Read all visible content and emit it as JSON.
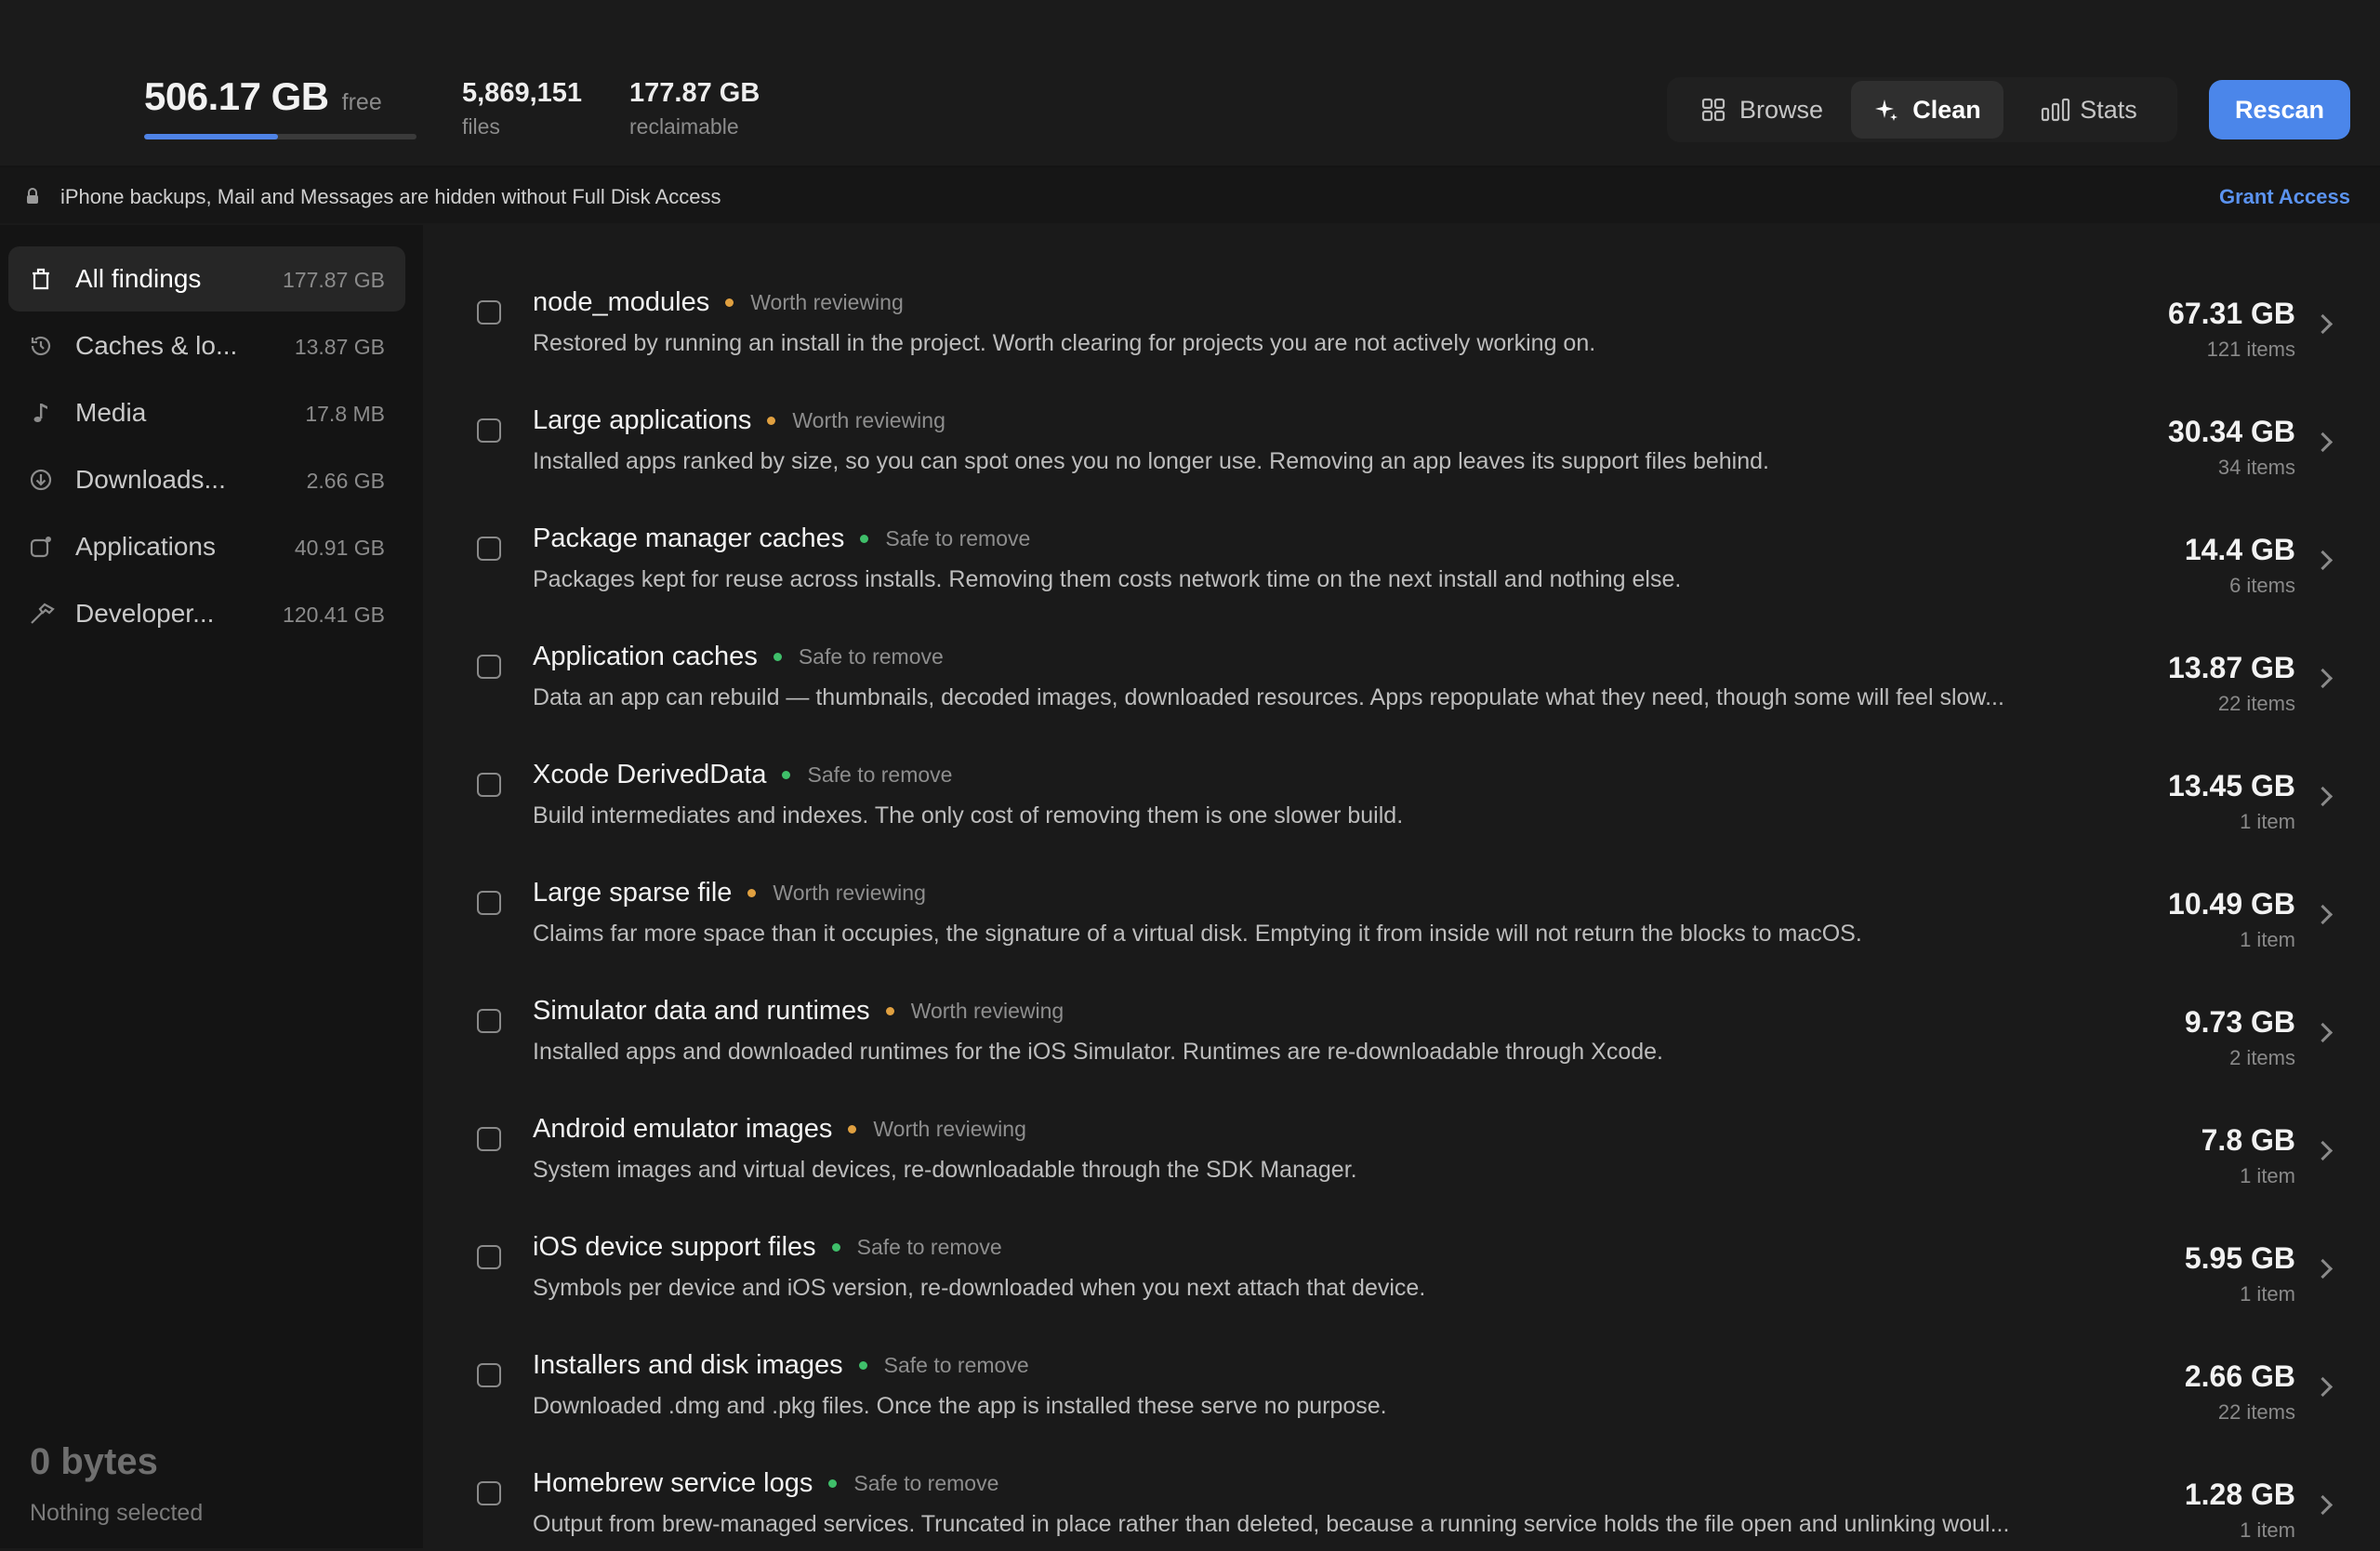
{
  "header": {
    "free_value": "506.17 GB",
    "free_unit": "free",
    "disk_used_fraction": 0.49,
    "files_value": "5,869,151",
    "files_label": "files",
    "reclaimable_value": "177.87 GB",
    "reclaimable_label": "reclaimable",
    "tabs": [
      {
        "label": "Browse",
        "icon": "grid-icon",
        "active": false
      },
      {
        "label": "Clean",
        "icon": "sparkle-icon",
        "active": true
      },
      {
        "label": "Stats",
        "icon": "bar-chart-icon",
        "active": false
      }
    ],
    "rescan_label": "Rescan"
  },
  "notice": {
    "text": "iPhone backups, Mail and Messages are hidden without Full Disk Access",
    "action_label": "Grant Access"
  },
  "sidebar": {
    "items": [
      {
        "label": "All findings",
        "size": "177.87 GB",
        "icon": "trash-icon"
      },
      {
        "label": "Caches & lo...",
        "size": "13.87 GB",
        "icon": "history-icon"
      },
      {
        "label": "Media",
        "size": "17.8 MB",
        "icon": "music-note-icon"
      },
      {
        "label": "Downloads...",
        "size": "2.66 GB",
        "icon": "download-icon"
      },
      {
        "label": "Applications",
        "size": "40.91 GB",
        "icon": "app-icon"
      },
      {
        "label": "Developer...",
        "size": "120.41 GB",
        "icon": "hammer-icon"
      }
    ],
    "selection_total": "0 bytes",
    "selection_label": "Nothing selected"
  },
  "colors": {
    "accent": "#4b86ea",
    "worth_reviewing": "#e0a040",
    "safe_to_remove": "#3fbf6a"
  },
  "findings": [
    {
      "title": "node_modules",
      "status": "Worth reviewing",
      "status_kind": "worth",
      "description": "Restored by running an install in the project. Worth clearing for projects you are not actively working on.",
      "size": "67.31 GB",
      "count": "121 items"
    },
    {
      "title": "Large applications",
      "status": "Worth reviewing",
      "status_kind": "worth",
      "description": "Installed apps ranked by size, so you can spot ones you no longer use. Removing an app leaves its support files behind.",
      "size": "30.34 GB",
      "count": "34 items"
    },
    {
      "title": "Package manager caches",
      "status": "Safe to remove",
      "status_kind": "safe",
      "description": "Packages kept for reuse across installs. Removing them costs network time on the next install and nothing else.",
      "size": "14.4 GB",
      "count": "6 items"
    },
    {
      "title": "Application caches",
      "status": "Safe to remove",
      "status_kind": "safe",
      "description": "Data an app can rebuild — thumbnails, decoded images, downloaded resources. Apps repopulate what they need, though some will feel slow...",
      "size": "13.87 GB",
      "count": "22 items"
    },
    {
      "title": "Xcode DerivedData",
      "status": "Safe to remove",
      "status_kind": "safe",
      "description": "Build intermediates and indexes. The only cost of removing them is one slower build.",
      "size": "13.45 GB",
      "count": "1 item"
    },
    {
      "title": "Large sparse file",
      "status": "Worth reviewing",
      "status_kind": "worth",
      "description": "Claims far more space than it occupies, the signature of a virtual disk. Emptying it from inside will not return the blocks to macOS.",
      "size": "10.49 GB",
      "count": "1 item"
    },
    {
      "title": "Simulator data and runtimes",
      "status": "Worth reviewing",
      "status_kind": "worth",
      "description": "Installed apps and downloaded runtimes for the iOS Simulator. Runtimes are re-downloadable through Xcode.",
      "size": "9.73 GB",
      "count": "2 items"
    },
    {
      "title": "Android emulator images",
      "status": "Worth reviewing",
      "status_kind": "worth",
      "description": "System images and virtual devices, re-downloadable through the SDK Manager.",
      "size": "7.8 GB",
      "count": "1 item"
    },
    {
      "title": "iOS device support files",
      "status": "Safe to remove",
      "status_kind": "safe",
      "description": "Symbols per device and iOS version, re-downloaded when you next attach that device.",
      "size": "5.95 GB",
      "count": "1 item"
    },
    {
      "title": "Installers and disk images",
      "status": "Safe to remove",
      "status_kind": "safe",
      "description": "Downloaded .dmg and .pkg files. Once the app is installed these serve no purpose.",
      "size": "2.66 GB",
      "count": "22 items"
    },
    {
      "title": "Homebrew service logs",
      "status": "Safe to remove",
      "status_kind": "safe",
      "description": "Output from brew-managed services. Truncated in place rather than deleted, because a running service holds the file open and unlinking woul...",
      "size": "1.28 GB",
      "count": "1 item"
    }
  ]
}
